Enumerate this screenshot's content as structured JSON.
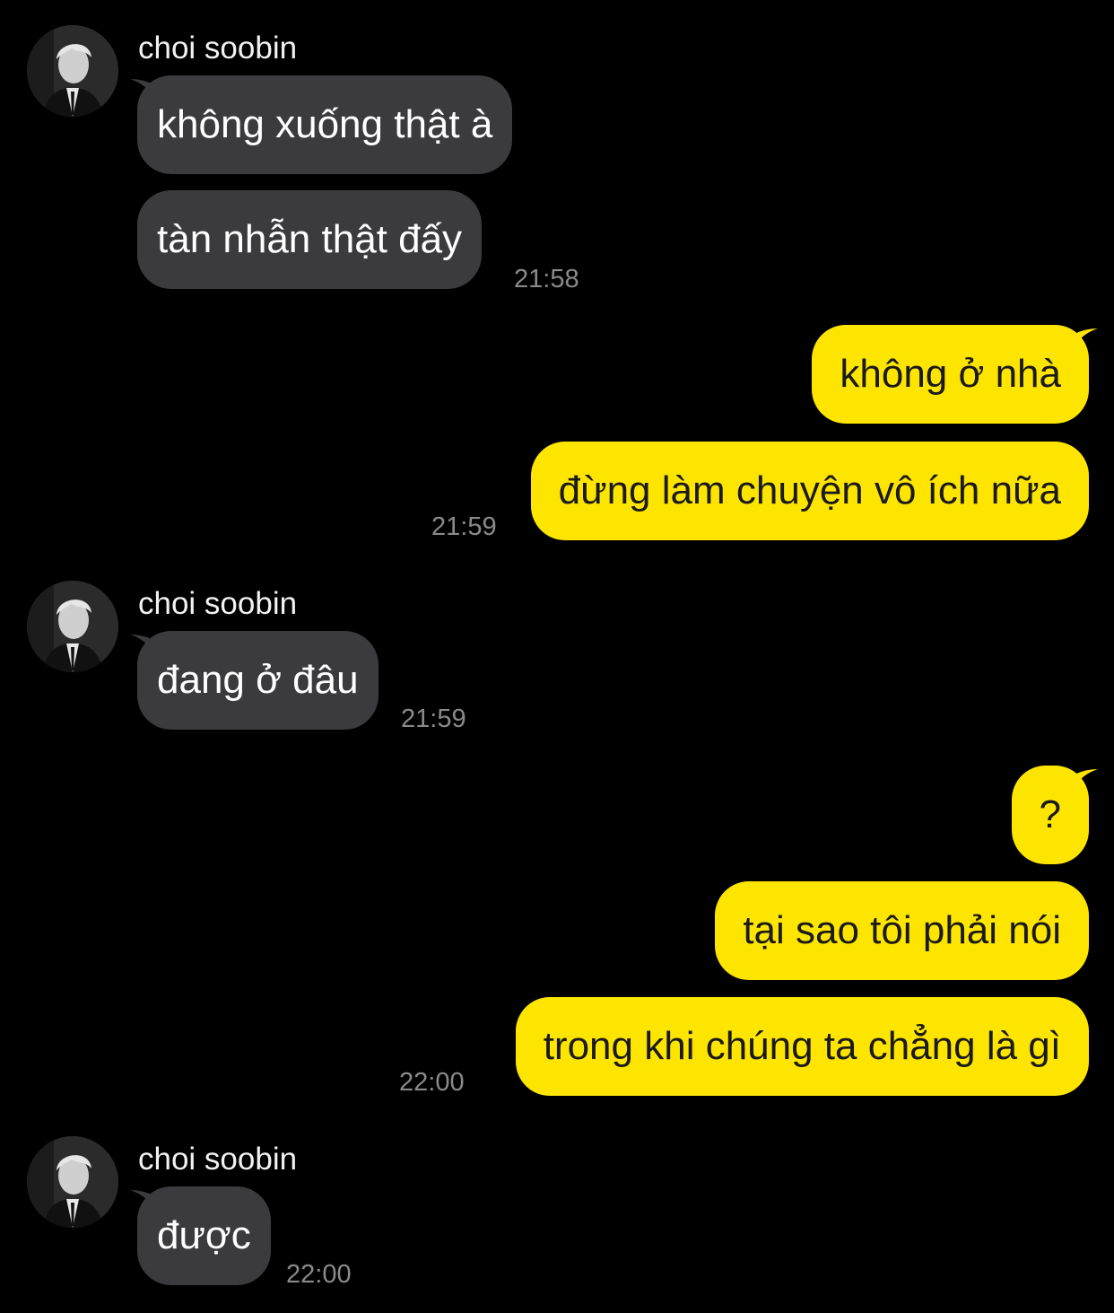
{
  "colors": {
    "background": "#000000",
    "incoming_bubble": "#3b3b3d",
    "outgoing_bubble": "#fee500",
    "timestamp": "#8a8a8a"
  },
  "groups": [
    {
      "direction": "incoming",
      "sender": "choi soobin",
      "avatar_icon": "profile-photo-avatar",
      "messages": [
        "không xuống thật à",
        "tàn nhẫn thật đấy"
      ],
      "time": "21:58"
    },
    {
      "direction": "outgoing",
      "messages": [
        "không ở nhà",
        "đừng làm chuyện vô ích nữa"
      ],
      "time": "21:59"
    },
    {
      "direction": "incoming",
      "sender": "choi soobin",
      "avatar_icon": "profile-photo-avatar",
      "messages": [
        "đang ở đâu"
      ],
      "time": "21:59"
    },
    {
      "direction": "outgoing",
      "messages": [
        "?",
        "tại sao tôi phải nói",
        "trong khi chúng ta chẳng là gì"
      ],
      "time": "22:00"
    },
    {
      "direction": "incoming",
      "sender": "choi soobin",
      "avatar_icon": "profile-photo-avatar",
      "messages": [
        "được"
      ],
      "time": "22:00"
    }
  ]
}
